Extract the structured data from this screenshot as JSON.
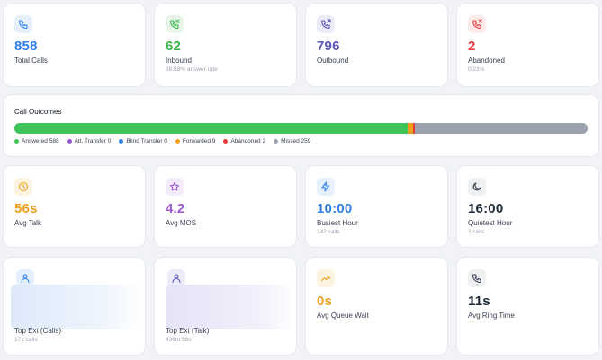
{
  "stats_row1": [
    {
      "value": "858",
      "label": "Total Calls",
      "sub": "",
      "color": "#2f80ed",
      "icon": "phone-icon"
    },
    {
      "value": "62",
      "label": "Inbound",
      "sub": "88.58% answer rate",
      "color": "#3bb54a",
      "icon": "phone-incoming-icon"
    },
    {
      "value": "796",
      "label": "Outbound",
      "sub": "",
      "color": "#5a57b5",
      "icon": "phone-outgoing-icon"
    },
    {
      "value": "2",
      "label": "Abandoned",
      "sub": "0.23%",
      "color": "#e53e3e",
      "icon": "phone-missed-icon"
    }
  ],
  "outcomes": {
    "title": "Call Outcomes",
    "segments": [
      {
        "label": "Answered",
        "count": 588,
        "color": "#3ec35a"
      },
      {
        "label": "Att. Transfer",
        "count": 0,
        "color": "#9b59d0"
      },
      {
        "label": "Blind Transfer",
        "count": 0,
        "color": "#2f80ed"
      },
      {
        "label": "Forwarded",
        "count": 9,
        "color": "#f0a020"
      },
      {
        "label": "Abandoned",
        "count": 2,
        "color": "#e53e3e"
      },
      {
        "label": "Missed",
        "count": 259,
        "color": "#9ca3af"
      }
    ],
    "legend_text": [
      "Answered 588",
      "Att. Transfer 0",
      "Blind Transfer 0",
      "Forwarded 9",
      "Abandoned 2",
      "Missed 259"
    ]
  },
  "stats_row2": [
    {
      "value": "56s",
      "label": "Avg Talk",
      "sub": "",
      "color": "#f0a020",
      "icon": "clock-icon"
    },
    {
      "value": "4.2",
      "label": "Avg MOS",
      "sub": "",
      "color": "#9b59d0",
      "icon": "star-icon"
    },
    {
      "value": "10:00",
      "label": "Busiest Hour",
      "sub": "142 calls",
      "color": "#2f80ed",
      "icon": "lightning-icon"
    },
    {
      "value": "16:00",
      "label": "Quietest Hour",
      "sub": "1 calls",
      "color": "#374151",
      "icon": "moon-icon"
    }
  ],
  "stats_row3": [
    {
      "value": "",
      "label": "Top Ext (Calls)",
      "sub": "171 calls",
      "color": "#2f80ed",
      "icon": "user-icon"
    },
    {
      "value": "",
      "label": "Top Ext (Talk)",
      "sub": "436m 58s",
      "color": "#5a57b5",
      "icon": "user-icon"
    },
    {
      "value": "0s",
      "label": "Avg Queue Wait",
      "sub": "",
      "color": "#f0a020",
      "icon": "trend-up-icon"
    },
    {
      "value": "11s",
      "label": "Avg Ring Time",
      "sub": "",
      "color": "#374151",
      "icon": "phone-icon"
    }
  ]
}
